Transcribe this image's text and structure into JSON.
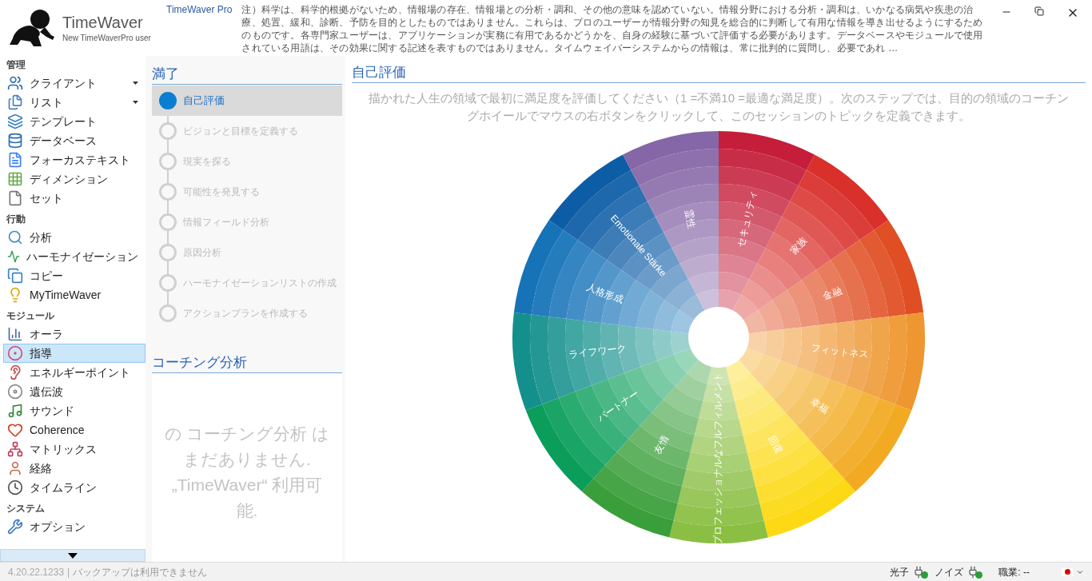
{
  "header": {
    "app_name": "TimeWaver",
    "user": "New TimeWaverPro user",
    "product": "TimeWaver Pro",
    "notice": "注）科学は、科学的根拠がないため、情報場の存在、情報場との分析・調和、その他の意味を認めていない。情報分野における分析・調和は、いかなる病気や疾患の治療、処置、緩和、診断、予防を目的としたものではありません。これらは、プロのユーザーが情報分野の知見を総合的に判断して有用な情報を導き出せるようにするためのものです。各専門家ユーザーは、アプリケーションが実務に有用であるかどうかを、自身の経験に基づいて評価する必要があります。データベースやモジュールで使用されている用語は、その効果に関する記述を表すものではありません。タイムウェイバーシステムからの情報は、常に批判的に質問し、必要であれ …"
  },
  "sidebar": {
    "sections": [
      {
        "title": "管理",
        "items": [
          {
            "label": "クライアント",
            "has_menu": true,
            "selected": false
          },
          {
            "label": "リスト",
            "has_menu": true,
            "selected": false
          },
          {
            "label": "テンプレート",
            "has_menu": false,
            "selected": false
          },
          {
            "label": "データベース",
            "has_menu": false,
            "selected": false
          },
          {
            "label": "フォーカステキスト",
            "has_menu": false,
            "selected": false
          },
          {
            "label": "ディメンション",
            "has_menu": false,
            "selected": false
          },
          {
            "label": "セット",
            "has_menu": false,
            "selected": false
          }
        ]
      },
      {
        "title": "行動",
        "items": [
          {
            "label": "分析",
            "has_menu": false,
            "selected": false
          },
          {
            "label": "ハーモナイゼーション",
            "has_menu": false,
            "selected": false
          },
          {
            "label": "コピー",
            "has_menu": false,
            "selected": false
          },
          {
            "label": "MyTimeWaver",
            "has_menu": false,
            "selected": false
          }
        ]
      },
      {
        "title": "モジュール",
        "items": [
          {
            "label": "オーラ",
            "has_menu": false,
            "selected": false
          },
          {
            "label": "指導",
            "has_menu": false,
            "selected": true
          },
          {
            "label": "エネルギーポイント",
            "has_menu": false,
            "selected": false
          },
          {
            "label": "遺伝波",
            "has_menu": false,
            "selected": false
          },
          {
            "label": "サウンド",
            "has_menu": false,
            "selected": false
          },
          {
            "label": "Coherence",
            "has_menu": false,
            "selected": false
          },
          {
            "label": "マトリックス",
            "has_menu": false,
            "selected": false
          },
          {
            "label": "経絡",
            "has_menu": false,
            "selected": false
          },
          {
            "label": "タイムライン",
            "has_menu": false,
            "selected": false
          }
        ]
      },
      {
        "title": "システム",
        "items": [
          {
            "label": "オプション",
            "has_menu": false,
            "selected": false
          }
        ]
      }
    ]
  },
  "steps": {
    "title": "満了",
    "items": [
      {
        "label": "自己評価",
        "selected": true
      },
      {
        "label": "ビジョンと目標を定義する",
        "selected": false
      },
      {
        "label": "現実を探る",
        "selected": false
      },
      {
        "label": "可能性を発見する",
        "selected": false
      },
      {
        "label": "情報フィールド分析",
        "selected": false
      },
      {
        "label": "原因分析",
        "selected": false
      },
      {
        "label": "ハーモナイゼーションリストの作成",
        "selected": false
      },
      {
        "label": "アクションプランを作成する",
        "selected": false
      }
    ]
  },
  "coaching_analysis": {
    "title": "コーチング分析",
    "empty_message": "の コーチング分析 はまだありません. „TimeWaver“ 利用可能."
  },
  "main": {
    "title": "自己評価",
    "instructions": "描かれた人生の領域で最初に満足度を評価してください（1 =不満10 =最適な満足度）。次のステップでは、目的の領域のコーチングホイールでマウスの右ボタンをクリックして、このセッションのトピックを定義できます。",
    "wheel": [
      {
        "label": "セキュリティ",
        "color": "#c41e3a"
      },
      {
        "label": "家族",
        "color": "#d9302c"
      },
      {
        "label": "金融",
        "color": "#e04e24"
      },
      {
        "label": "フィットネス",
        "color": "#ee9630"
      },
      {
        "label": "幸福",
        "color": "#f2aa22"
      },
      {
        "label": "回復",
        "color": "#fcd914"
      },
      {
        "label": "プロフェッショナルなフルフィルメント",
        "color": "#8abf43"
      },
      {
        "label": "友情",
        "color": "#3a9e3a"
      },
      {
        "label": "パートナー",
        "color": "#0a9e5a"
      },
      {
        "label": "ライフワーク",
        "color": "#14908c"
      },
      {
        "label": "人格形成",
        "color": "#1673b8"
      },
      {
        "label": "Emotionale Stärke",
        "color": "#0d5ca6"
      },
      {
        "label": "霊性",
        "color": "#8566a6"
      }
    ]
  },
  "status_bar": {
    "version": "4.20.22.1233",
    "separator": "|",
    "backup": "バックアップは利用できません",
    "photon_label": "光子",
    "noise_label": "ノイズ",
    "occupation": "職業: --"
  }
}
